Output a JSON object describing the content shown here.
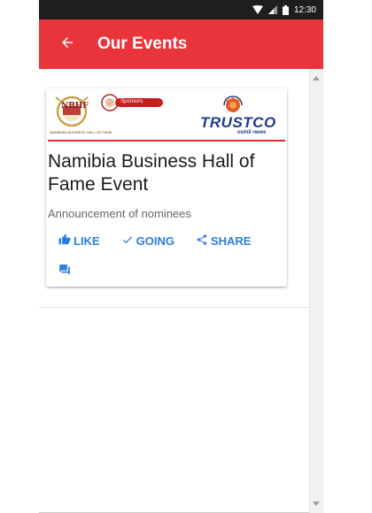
{
  "status_bar": {
    "time": "12:30"
  },
  "app_bar": {
    "title": "Our Events"
  },
  "card": {
    "banner": {
      "left_logo_text": "NBHF",
      "left_logo_subtext": "NAMIBIAN BUSINESS HALL OF FAME",
      "sponsors_label": "Sponsors",
      "sponsor_name": "TRUSTCO",
      "sponsor_tagline": "oshili news"
    },
    "title": "Namibia Business Hall of Fame Event",
    "subtitle": "Announcement of nominees",
    "actions": {
      "like_label": "LIKE",
      "going_label": "GOING",
      "share_label": "SHARE"
    }
  },
  "colors": {
    "app_bar": "#e8343a",
    "status_bar": "#1e1e1e",
    "action_blue": "#2a7fe0"
  },
  "icons": {
    "back": "arrow-left-icon",
    "like": "thumbs-up-icon",
    "going": "check-icon",
    "share": "share-icon",
    "chat": "chat-bubbles-icon"
  }
}
